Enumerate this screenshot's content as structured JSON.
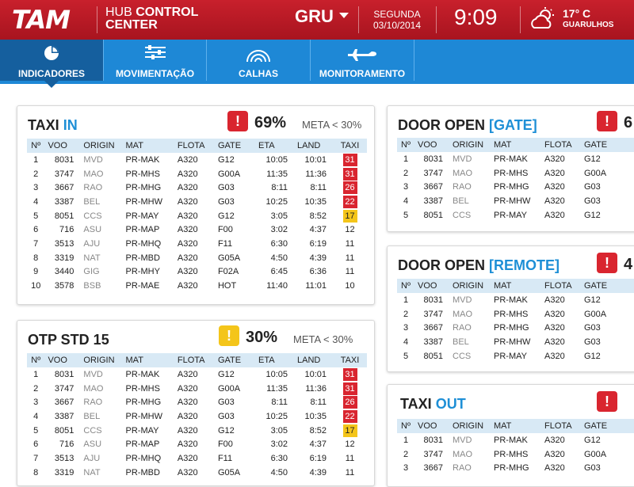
{
  "header": {
    "logo": "TAM",
    "hub_line1": "HUB",
    "hub_line1_bold": "CONTROL",
    "hub_line2": "CENTER",
    "airport": "GRU",
    "weekday": "SEGUNDA",
    "date": "03/10/2014",
    "time": "9:09",
    "temperature": "17° C",
    "city": "GUARULHOS",
    "weather_icon": "partly-cloudy-icon"
  },
  "nav": {
    "items": [
      {
        "label": "INDICADORES",
        "icon": "pie-chart-icon"
      },
      {
        "label": "MOVIMENTAÇÃO",
        "icon": "sliders-icon"
      },
      {
        "label": "CALHAS",
        "icon": "arcs-icon"
      },
      {
        "label": "MONITORAMENTO",
        "icon": "airplane-icon"
      }
    ],
    "active": "INDICADORES"
  },
  "colors": {
    "brand_red": "#c8202c",
    "nav_blue": "#1e88d6",
    "nav_active": "#155f9e",
    "accent_blue": "#1e8fd6",
    "alert_red": "#d9252f",
    "alert_yellow": "#f4c51a",
    "header_row": "#d8e9f5"
  },
  "cards": {
    "taxi_in": {
      "title": "TAXI",
      "title_hl": "IN",
      "alert": "!",
      "pct": "69%",
      "meta": "META < 30%",
      "columns": [
        "Nº",
        "VOO",
        "ORIGIN",
        "MAT",
        "FLOTA",
        "GATE",
        "ETA",
        "LAND",
        "TAXI"
      ],
      "rows": [
        [
          "1",
          "8031",
          "MVD",
          "PR-MAK",
          "A320",
          "G12",
          "10:05",
          "10:01",
          "31"
        ],
        [
          "2",
          "3747",
          "MAO",
          "PR-MHS",
          "A320",
          "G00A",
          "11:35",
          "11:36",
          "31"
        ],
        [
          "3",
          "3667",
          "RAO",
          "PR-MHG",
          "A320",
          "G03",
          "8:11",
          "8:11",
          "26"
        ],
        [
          "4",
          "3387",
          "BEL",
          "PR-MHW",
          "A320",
          "G03",
          "10:25",
          "10:35",
          "22"
        ],
        [
          "5",
          "8051",
          "CCS",
          "PR-MAY",
          "A320",
          "G12",
          "3:05",
          "8:52",
          "17"
        ],
        [
          "6",
          "716",
          "ASU",
          "PR-MAP",
          "A320",
          "F00",
          "3:02",
          "4:37",
          "12"
        ],
        [
          "7",
          "3513",
          "AJU",
          "PR-MHQ",
          "A320",
          "F11",
          "6:30",
          "6:19",
          "11"
        ],
        [
          "8",
          "3319",
          "NAT",
          "PR-MBD",
          "A320",
          "G05A",
          "4:50",
          "4:39",
          "11"
        ],
        [
          "9",
          "3440",
          "GIG",
          "PR-MHY",
          "A320",
          "F02A",
          "6:45",
          "6:36",
          "11"
        ],
        [
          "10",
          "3578",
          "BSB",
          "PR-MAE",
          "A320",
          "HOT",
          "11:40",
          "11:01",
          "10"
        ]
      ],
      "badge_levels": [
        "red",
        "red",
        "red",
        "red",
        "yellow",
        "none",
        "none",
        "none",
        "none",
        "none"
      ]
    },
    "otp_std": {
      "title": "OTP STD 15",
      "title_hl": "",
      "alert": "!",
      "pct": "30%",
      "meta": "META < 30%",
      "columns": [
        "Nº",
        "VOO",
        "ORIGIN",
        "MAT",
        "FLOTA",
        "GATE",
        "ETA",
        "LAND",
        "TAXI"
      ],
      "rows": [
        [
          "1",
          "8031",
          "MVD",
          "PR-MAK",
          "A320",
          "G12",
          "10:05",
          "10:01",
          "31"
        ],
        [
          "2",
          "3747",
          "MAO",
          "PR-MHS",
          "A320",
          "G00A",
          "11:35",
          "11:36",
          "31"
        ],
        [
          "3",
          "3667",
          "RAO",
          "PR-MHG",
          "A320",
          "G03",
          "8:11",
          "8:11",
          "26"
        ],
        [
          "4",
          "3387",
          "BEL",
          "PR-MHW",
          "A320",
          "G03",
          "10:25",
          "10:35",
          "22"
        ],
        [
          "5",
          "8051",
          "CCS",
          "PR-MAY",
          "A320",
          "G12",
          "3:05",
          "8:52",
          "17"
        ],
        [
          "6",
          "716",
          "ASU",
          "PR-MAP",
          "A320",
          "F00",
          "3:02",
          "4:37",
          "12"
        ],
        [
          "7",
          "3513",
          "AJU",
          "PR-MHQ",
          "A320",
          "F11",
          "6:30",
          "6:19",
          "11"
        ],
        [
          "8",
          "3319",
          "NAT",
          "PR-MBD",
          "A320",
          "G05A",
          "4:50",
          "4:39",
          "11"
        ]
      ],
      "badge_levels": [
        "red",
        "red",
        "red",
        "red",
        "yellow",
        "none",
        "none",
        "none"
      ]
    },
    "door_gate": {
      "title": "DOOR OPEN",
      "title_hl": "[GATE]",
      "alert": "!",
      "pct": "6",
      "columns": [
        "Nº",
        "VOO",
        "ORIGIN",
        "MAT",
        "FLOTA",
        "GATE"
      ],
      "rows": [
        [
          "1",
          "8031",
          "MVD",
          "PR-MAK",
          "A320",
          "G12"
        ],
        [
          "2",
          "3747",
          "MAO",
          "PR-MHS",
          "A320",
          "G00A"
        ],
        [
          "3",
          "3667",
          "RAO",
          "PR-MHG",
          "A320",
          "G03"
        ],
        [
          "4",
          "3387",
          "BEL",
          "PR-MHW",
          "A320",
          "G03"
        ],
        [
          "5",
          "8051",
          "CCS",
          "PR-MAY",
          "A320",
          "G12"
        ]
      ],
      "edge_values": [
        "1",
        "1",
        "1",
        "1",
        "1"
      ]
    },
    "door_remote": {
      "title": "DOOR OPEN",
      "title_hl": "[REMOTE]",
      "alert": "!",
      "pct": "4",
      "columns": [
        "Nº",
        "VOO",
        "ORIGIN",
        "MAT",
        "FLOTA",
        "GATE"
      ],
      "rows": [
        [
          "1",
          "8031",
          "MVD",
          "PR-MAK",
          "A320",
          "G12"
        ],
        [
          "2",
          "3747",
          "MAO",
          "PR-MHS",
          "A320",
          "G00A"
        ],
        [
          "3",
          "3667",
          "RAO",
          "PR-MHG",
          "A320",
          "G03"
        ],
        [
          "4",
          "3387",
          "BEL",
          "PR-MHW",
          "A320",
          "G03"
        ],
        [
          "5",
          "8051",
          "CCS",
          "PR-MAY",
          "A320",
          "G12"
        ]
      ],
      "edge_values": [
        "1",
        "1",
        "",
        "1",
        "1"
      ]
    },
    "taxi_out": {
      "title": "TAXI",
      "title_hl": "OUT",
      "alert": "!",
      "columns": [
        "Nº",
        "VOO",
        "ORIGIN",
        "MAT",
        "FLOTA",
        "GATE"
      ],
      "rows": [
        [
          "1",
          "8031",
          "MVD",
          "PR-MAK",
          "A320",
          "G12"
        ],
        [
          "2",
          "3747",
          "MAO",
          "PR-MHS",
          "A320",
          "G00A"
        ],
        [
          "3",
          "3667",
          "RAO",
          "PR-MHG",
          "A320",
          "G03"
        ]
      ],
      "edge_values": [
        "1",
        "1",
        "1"
      ]
    }
  }
}
